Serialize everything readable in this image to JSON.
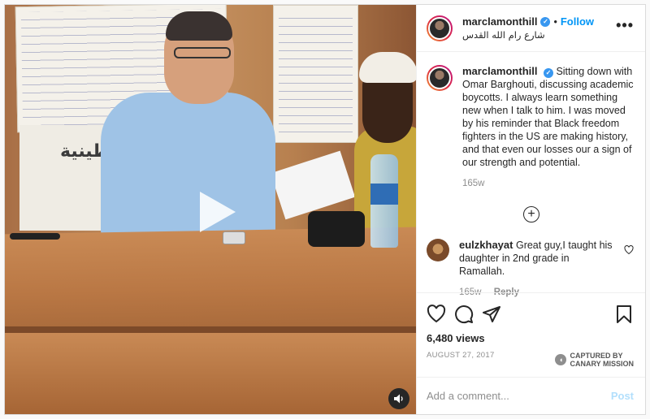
{
  "header": {
    "username": "marclamonthill",
    "follow_label": "Follow",
    "location": "شارع رام الله القدس",
    "separator": "•",
    "more_label": "•••"
  },
  "caption": {
    "username": "marclamonthill",
    "text": "Sitting down with Omar Barghouti, discussing academic boycotts. I always learn something new when I talk to him. I was moved by his reminder that Black freedom fighters in the US are making history, and that even our losses our a sign of our strength and potential.",
    "time": "165w"
  },
  "comments": [
    {
      "username": "eulzkhayat",
      "text": "Great guy,I taught his daughter in 2nd grade in Ramallah.",
      "time": "165w",
      "reply_label": "Reply"
    }
  ],
  "load_more_label": "+",
  "media": {
    "banner_text": "طينية"
  },
  "stats": {
    "views": "6,480 views",
    "date": "AUGUST 27, 2017"
  },
  "watermark": {
    "line1": "CAPTURED BY",
    "line2": "CANARY MISSION"
  },
  "add_comment": {
    "placeholder": "Add a comment...",
    "post_label": "Post"
  },
  "icons": {
    "verified": "verified-badge-icon",
    "like": "heart-icon",
    "comment": "comment-bubble-icon",
    "share": "paper-plane-icon",
    "save": "bookmark-icon",
    "play": "play-icon",
    "sound": "speaker-icon"
  },
  "colors": {
    "accent": "#0095f6",
    "post_disabled": "#b2dffc",
    "muted": "#8e8e8e",
    "text": "#262626"
  }
}
